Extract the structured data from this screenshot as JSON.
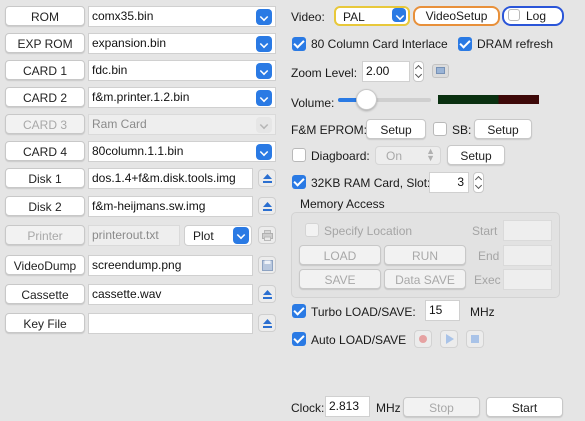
{
  "left_rows": [
    {
      "label": "ROM",
      "value": "comx35.bin",
      "control": "dropdown",
      "enabled": true
    },
    {
      "label": "EXP ROM",
      "value": "expansion.bin",
      "control": "dropdown",
      "enabled": true
    },
    {
      "label": "CARD 1",
      "value": "fdc.bin",
      "control": "dropdown",
      "enabled": true
    },
    {
      "label": "CARD 2",
      "value": "f&m.printer.1.2.bin",
      "control": "dropdown",
      "enabled": true
    },
    {
      "label": "CARD 3",
      "value": "Ram Card",
      "control": "dropdown",
      "enabled": false
    },
    {
      "label": "CARD 4",
      "value": "80column.1.1.bin",
      "control": "dropdown",
      "enabled": true
    },
    {
      "label": "Disk 1",
      "value": "dos.1.4+f&m.disk.tools.img",
      "control": "eject",
      "enabled": true
    },
    {
      "label": "Disk 2",
      "value": "f&m-heijmans.sw.img",
      "control": "eject",
      "enabled": true
    },
    {
      "label": "Printer",
      "value": "printerout.txt",
      "control": "printer",
      "enabled": false
    },
    {
      "label": "VideoDump",
      "value": "screendump.png",
      "control": "save",
      "enabled": true
    },
    {
      "label": "Cassette",
      "value": "cassette.wav",
      "control": "eject",
      "enabled": true
    },
    {
      "label": "Key File",
      "value": "",
      "control": "eject",
      "enabled": true
    }
  ],
  "printer_mode": "Plot",
  "video": {
    "label": "Video:",
    "mode": "PAL",
    "setup_button": "VideoSetup",
    "log_button": "Log"
  },
  "checks": {
    "col80": {
      "label": "80 Column Card Interlace",
      "checked": true
    },
    "dram": {
      "label": "DRAM refresh",
      "checked": true
    },
    "sb": {
      "label": "SB:",
      "checked": false
    },
    "diagboard": {
      "label": "Diagboard:",
      "checked": false
    },
    "ram32": {
      "label": "32KB RAM Card, Slot:",
      "checked": true
    },
    "specify": {
      "label": "Specify Location",
      "checked": false
    },
    "turbo": {
      "label": "Turbo LOAD/SAVE:",
      "checked": true
    },
    "auto": {
      "label": "Auto LOAD/SAVE",
      "checked": true
    }
  },
  "zoom": {
    "label": "Zoom Level:",
    "value": "2.00"
  },
  "volume": {
    "label": "Volume:",
    "level": 0.1
  },
  "eprom": {
    "label": "F&M EPROM:",
    "setup": "Setup"
  },
  "sb_setup": "Setup",
  "diag": {
    "value": "On",
    "setup": "Setup"
  },
  "ram_slot": "3",
  "memory": {
    "title": "Memory Access",
    "load": "LOAD",
    "run": "RUN",
    "save": "SAVE",
    "data_save": "Data SAVE",
    "start": "Start",
    "end": "End",
    "exec": "Exec"
  },
  "turbo_value": "15",
  "turbo_unit": "MHz",
  "clock": {
    "label": "Clock:",
    "value": "2.813",
    "unit": "MHz",
    "stop": "Stop",
    "start": "Start"
  },
  "colors": {
    "accent": "#2a7ae4",
    "video_focus": "#e8c83a",
    "setup_focus": "#e8903a",
    "log_focus": "#2a55d8"
  }
}
